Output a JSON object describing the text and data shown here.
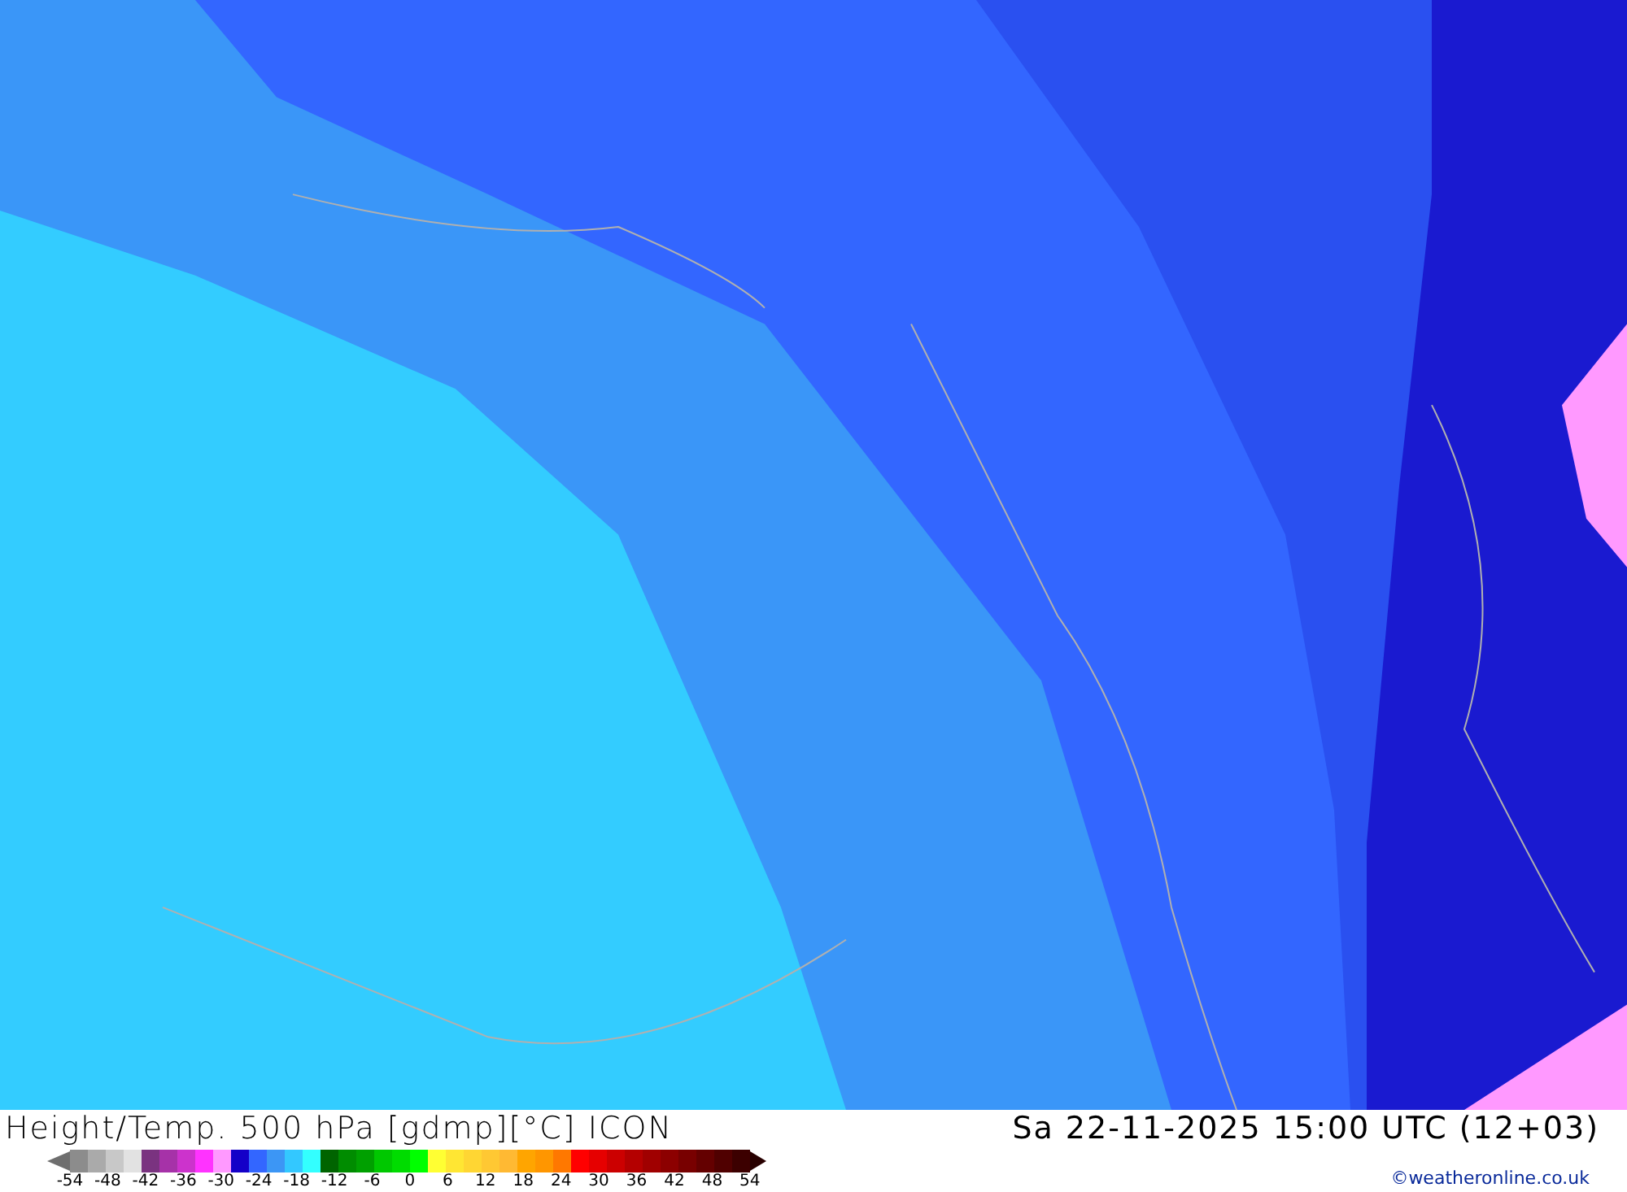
{
  "footer": {
    "title": "Height/Temp. 500 hPa [gdmp][°C] ICON",
    "datetime": "Sa 22-11-2025 15:00 UTC (12+03)",
    "copyright": "©weatheronline.co.uk"
  },
  "legend": {
    "swatches": [
      {
        "color": "#8c8c8c"
      },
      {
        "color": "#aaaaaa"
      },
      {
        "color": "#c8c8c8"
      },
      {
        "color": "#e2e2e2"
      },
      {
        "color": "#7a3380"
      },
      {
        "color": "#a632a8"
      },
      {
        "color": "#cc33cc"
      },
      {
        "color": "#ff33ff"
      },
      {
        "color": "#ff99ff"
      },
      {
        "color": "#1400c8"
      },
      {
        "color": "#3366ff"
      },
      {
        "color": "#3c96f5"
      },
      {
        "color": "#33c8ff"
      },
      {
        "color": "#33ffff"
      },
      {
        "color": "#006400"
      },
      {
        "color": "#008c00"
      },
      {
        "color": "#00a000"
      },
      {
        "color": "#00c800"
      },
      {
        "color": "#00dc00"
      },
      {
        "color": "#00ff00"
      },
      {
        "color": "#ffff33"
      },
      {
        "color": "#ffe633"
      },
      {
        "color": "#ffd633"
      },
      {
        "color": "#ffc833"
      },
      {
        "color": "#ffb933"
      },
      {
        "color": "#ffa500"
      },
      {
        "color": "#ff9600"
      },
      {
        "color": "#ff7800"
      },
      {
        "color": "#ff0000"
      },
      {
        "color": "#e60000"
      },
      {
        "color": "#cc0000"
      },
      {
        "color": "#b40000"
      },
      {
        "color": "#a00000"
      },
      {
        "color": "#8c0000"
      },
      {
        "color": "#780000"
      },
      {
        "color": "#640000"
      },
      {
        "color": "#500000"
      },
      {
        "color": "#3c0000"
      }
    ],
    "ticks": [
      "-54",
      "-48",
      "-42",
      "-36",
      "-30",
      "-24",
      "-18",
      "-12",
      "-6",
      "0",
      "6",
      "12",
      "18",
      "24",
      "30",
      "36",
      "42",
      "48",
      "54"
    ]
  }
}
